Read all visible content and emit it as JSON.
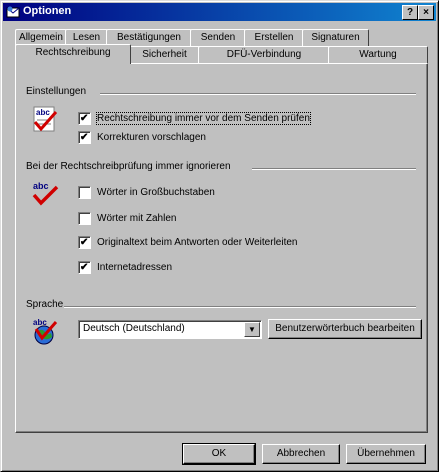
{
  "window": {
    "title": "Optionen",
    "help_label": "?",
    "close_label": "×"
  },
  "tabs_row1": [
    "Allgemein",
    "Lesen",
    "Bestätigungen",
    "Senden",
    "Erstellen",
    "Signaturen"
  ],
  "tabs_row2": [
    "Rechtschreibung",
    "Sicherheit",
    "DFÜ-Verbindung",
    "Wartung"
  ],
  "active_tab": "Rechtschreibung",
  "settings": {
    "group_label": "Einstellungen",
    "options": [
      {
        "label": "Rechtschreibung immer vor dem Senden prüfen",
        "checked": true
      },
      {
        "label": "Korrekturen vorschlagen",
        "checked": true
      }
    ]
  },
  "ignore": {
    "group_label": "Bei der Rechtschreibprüfung immer ignorieren",
    "options": [
      {
        "label": "Wörter in Großbuchstaben",
        "checked": false
      },
      {
        "label": "Wörter mit Zahlen",
        "checked": false
      },
      {
        "label": "Originaltext beim Antworten oder Weiterleiten",
        "checked": true
      },
      {
        "label": "Internetadressen",
        "checked": true
      }
    ]
  },
  "language": {
    "group_label": "Sprache",
    "selected": "Deutsch (Deutschland)",
    "edit_dictionary_label": "Benutzerwörterbuch bearbeiten"
  },
  "footer": {
    "ok_label": "OK",
    "cancel_label": "Abbrechen",
    "apply_label": "Übernehmen"
  },
  "check_glyph": "✔",
  "dropdown_glyph": "▼",
  "colors": {
    "title_start": "#000080",
    "title_end": "#1084d0",
    "face": "#c0c0c0"
  }
}
